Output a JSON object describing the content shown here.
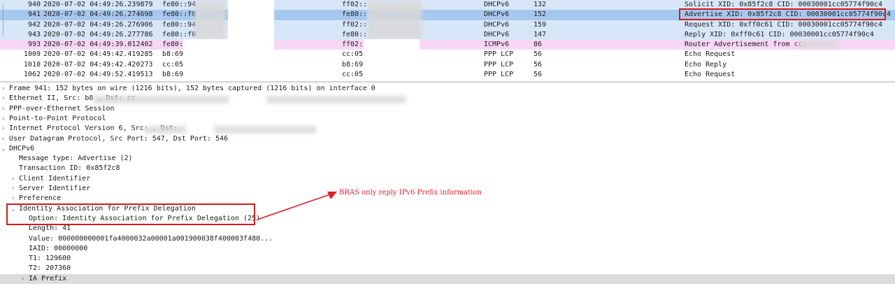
{
  "colors": {
    "dhcp_row": "#d7e6f7",
    "selected_row": "#a7c8ee",
    "icmp_row": "#f7d7f5",
    "default_row": "#ffffff",
    "highlight_red": "#d7191c",
    "annotation_red": "#e0202a"
  },
  "packets": [
    {
      "no": "940",
      "time": "2020-07-02 04:49:26.239879",
      "src": "fe80::94",
      "dst": "ff02::",
      "proto": "DHCPv6",
      "len": "132",
      "info": "Solicit XID: 0x85f2c8 CID: 00030001cc05774f90c4",
      "color": "#d7e6f7"
    },
    {
      "no": "941",
      "time": "2020-07-02 04:49:26.274698",
      "src": "fe80::f0",
      "dst": "fe80::",
      "proto": "DHCPv6",
      "len": "152",
      "info": "Advertise XID: 0x85f2c8 CID: 00030001cc05774f90c4",
      "color": "#a7c8ee"
    },
    {
      "no": "942",
      "time": "2020-07-02 04:49:26.276906",
      "src": "fe80::94",
      "dst": "ff02::",
      "proto": "DHCPv6",
      "len": "159",
      "info": "Request XID: 0xff0c61 CID: 00030001cc05774f90c4",
      "color": "#d7e6f7"
    },
    {
      "no": "943",
      "time": "2020-07-02 04:49:26.277786",
      "src": "fe80::f0",
      "dst": "fe80::",
      "proto": "DHCPv6",
      "len": "147",
      "info": "Reply XID: 0xff0c61 CID: 00030001cc05774f90c4",
      "color": "#d7e6f7"
    },
    {
      "no": "993",
      "time": "2020-07-02 04:49:39.012402",
      "src": "fe80::1",
      "dst": "ff02::1",
      "proto": "ICMPv6",
      "len": "86",
      "info": "Router Advertisement from cc:",
      "color": "#f7d7f5"
    },
    {
      "no": "1009",
      "time": "2020-07-02 04:49:42.419285",
      "src": "b8:69:f4",
      "dst": "cc:05:",
      "proto": "PPP LCP",
      "len": "56",
      "info": "Echo Request",
      "color": "#ffffff"
    },
    {
      "no": "1010",
      "time": "2020-07-02 04:49:42.420273",
      "src": "cc:05:77",
      "dst": "b8:69:",
      "proto": "PPP LCP",
      "len": "56",
      "info": "Echo Reply",
      "color": "#ffffff"
    },
    {
      "no": "1062",
      "time": "2020-07-02 04:49:52.419513",
      "src": "b8:69:f4",
      "dst": "cc:05:",
      "proto": "PPP LCP",
      "len": "56",
      "info": "Echo Request",
      "color": "#ffffff"
    }
  ],
  "tree": [
    {
      "indent": 0,
      "arrow": "›",
      "text": "Frame 941: 152 bytes on wire (1216 bits), 152 bytes captured (1216 bits) on interface 0"
    },
    {
      "indent": 0,
      "arrow": "›",
      "text": "Ethernet II, Src: b8                                        , Dst: cc"
    },
    {
      "indent": 0,
      "arrow": "›",
      "text": "PPP-over-Ethernet Session"
    },
    {
      "indent": 0,
      "arrow": "›",
      "text": "Point-to-Point Protocol"
    },
    {
      "indent": 0,
      "arrow": "›",
      "text": "Internet Protocol Version 6, Src:            , Dst:"
    },
    {
      "indent": 0,
      "arrow": "›",
      "text": "User Datagram Protocol, Src Port: 547, Dst Port: 546"
    },
    {
      "indent": 0,
      "arrow": "⌄",
      "text": "DHCPv6"
    },
    {
      "indent": 1,
      "arrow": "",
      "text": "Message type: Advertise (2)"
    },
    {
      "indent": 1,
      "arrow": "",
      "text": "Transaction ID: 0x85f2c8"
    },
    {
      "indent": 1,
      "arrow": "›",
      "text": "Client Identifier"
    },
    {
      "indent": 1,
      "arrow": "›",
      "text": "Server Identifier"
    },
    {
      "indent": 1,
      "arrow": "›",
      "text": "Preference"
    },
    {
      "indent": 1,
      "arrow": "⌄",
      "text": "Identity Association for Prefix Delegation"
    },
    {
      "indent": 2,
      "arrow": "",
      "text": "Option: Identity Association for Prefix Delegation (25)"
    },
    {
      "indent": 2,
      "arrow": "",
      "text": "Length: 41"
    },
    {
      "indent": 2,
      "arrow": "",
      "text": "Value: 000000000001fa4000032a00001a001900038f400003f480..."
    },
    {
      "indent": 2,
      "arrow": "",
      "text": "IAID: 00000000"
    },
    {
      "indent": 2,
      "arrow": "",
      "text": "T1: 129600"
    },
    {
      "indent": 2,
      "arrow": "",
      "text": "T2: 207360"
    },
    {
      "indent": 2,
      "arrow": "›",
      "text": "IA Prefix"
    }
  ],
  "annotation": "BRAS only reply IPv6 Prefix information"
}
